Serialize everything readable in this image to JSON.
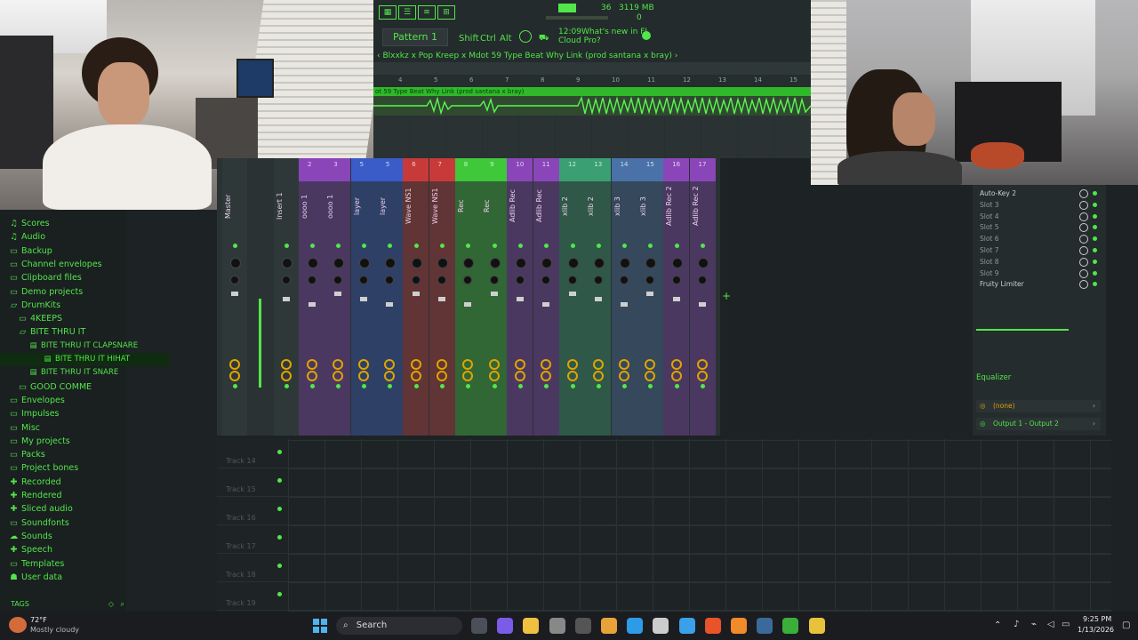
{
  "toolbar": {
    "pattern": "Pattern 1",
    "tempo_display": "36",
    "memory": "3119 MB",
    "cpu": "0",
    "keys": [
      "Shift",
      "Ctrl",
      "Alt"
    ],
    "news_time": "12:09",
    "news_text_1": "What's new in FL",
    "news_text_2": "Cloud Pro?"
  },
  "playlist": {
    "breadcrumb": "Blxxkz x Pop Kreep x Mdot 59 Type Beat Why Link (prod santana x bray)",
    "clip_title": "ot 59 Type Beat Why Link (prod santana x bray)",
    "ruler": [
      "4",
      "5",
      "6",
      "7",
      "8",
      "9",
      "10",
      "11",
      "12",
      "13",
      "14",
      "15"
    ]
  },
  "mixer": {
    "strips": [
      {
        "num": "",
        "label": "Master",
        "color": "#3a4445"
      },
      {
        "num": "",
        "label": "Insert 1",
        "color": "#3a4445"
      },
      {
        "num": "2",
        "label": "oooo 1",
        "color": "#8a46b8"
      },
      {
        "num": "3",
        "label": "oooo 1",
        "color": "#8a46b8"
      },
      {
        "num": "5",
        "label": "layer",
        "color": "#3a5cc8"
      },
      {
        "num": "5",
        "label": "layer",
        "color": "#3a5cc8"
      },
      {
        "num": "6",
        "label": "Wave NS1",
        "color": "#c83a3a"
      },
      {
        "num": "7",
        "label": "Wave NS1",
        "color": "#c83a3a"
      },
      {
        "num": "8",
        "label": "Rec",
        "color": "#3ec83a"
      },
      {
        "num": "9",
        "label": "Rec",
        "color": "#3ec83a"
      },
      {
        "num": "10",
        "label": "Adlib Rec",
        "color": "#8a46b8"
      },
      {
        "num": "11",
        "label": "Adlib Rec",
        "color": "#8a46b8"
      },
      {
        "num": "12",
        "label": "xlib 2",
        "color": "#3aa074"
      },
      {
        "num": "13",
        "label": "xlib 2",
        "color": "#3aa074"
      },
      {
        "num": "14",
        "label": "xlib 3",
        "color": "#4a72a8"
      },
      {
        "num": "15",
        "label": "xlib 3",
        "color": "#4a72a8"
      },
      {
        "num": "16",
        "label": "Adlib Rec 2",
        "color": "#8a46b8"
      },
      {
        "num": "17",
        "label": "Adlib Rec 2",
        "color": "#8a46b8"
      }
    ]
  },
  "browser": {
    "items": [
      {
        "label": "Scores",
        "icon": "note-icon",
        "indent": 0
      },
      {
        "label": "Audio",
        "icon": "note-icon",
        "indent": 0
      },
      {
        "label": "Backup",
        "icon": "folder-icon",
        "indent": 0
      },
      {
        "label": "Channel envelopes",
        "icon": "folder-icon",
        "indent": 0
      },
      {
        "label": "Clipboard files",
        "icon": "folder-icon",
        "indent": 0
      },
      {
        "label": "Demo projects",
        "icon": "folder-icon",
        "indent": 0
      },
      {
        "label": "DrumKits",
        "icon": "folder-open-icon",
        "indent": 0
      },
      {
        "label": "4KEEPS",
        "icon": "folder-icon",
        "indent": 1
      },
      {
        "label": "BITE THRU IT",
        "icon": "folder-open-icon",
        "indent": 1
      },
      {
        "label": "BITE THRU IT CLAPSNARE",
        "icon": "file-icon",
        "indent": 2
      },
      {
        "label": "BITE THRU IT HIHAT",
        "icon": "file-icon",
        "indent": 3
      },
      {
        "label": "BITE THRU IT SNARE",
        "icon": "file-icon",
        "indent": 2
      },
      {
        "label": "GOOD COMME",
        "icon": "folder-icon",
        "indent": 1
      },
      {
        "label": "Envelopes",
        "icon": "folder-icon",
        "indent": 0
      },
      {
        "label": "Impulses",
        "icon": "folder-icon",
        "indent": 0
      },
      {
        "label": "Misc",
        "icon": "folder-icon",
        "indent": 0
      },
      {
        "label": "My projects",
        "icon": "folder-icon",
        "indent": 0
      },
      {
        "label": "Packs",
        "icon": "folder-icon",
        "indent": 0
      },
      {
        "label": "Project bones",
        "icon": "folder-icon",
        "indent": 0
      },
      {
        "label": "Recorded",
        "icon": "plus-icon",
        "indent": 0
      },
      {
        "label": "Rendered",
        "icon": "plus-icon",
        "indent": 0
      },
      {
        "label": "Sliced audio",
        "icon": "plus-icon",
        "indent": 0
      },
      {
        "label": "Soundfonts",
        "icon": "folder-icon",
        "indent": 0
      },
      {
        "label": "Sounds",
        "icon": "cloud-icon",
        "indent": 0
      },
      {
        "label": "Speech",
        "icon": "plus-icon",
        "indent": 0
      },
      {
        "label": "Templates",
        "icon": "folder-icon",
        "indent": 0
      },
      {
        "label": "User data",
        "icon": "user-icon",
        "indent": 0
      }
    ],
    "tags_label": "TAGS"
  },
  "fx": {
    "slots": [
      "Auto-Key 2",
      "Slot 3",
      "Slot 4",
      "Slot 5",
      "Slot 6",
      "Slot 7",
      "Slot 8",
      "Slot 9",
      "Fruity Limiter"
    ],
    "equalizer_label": "Equalizer",
    "input": "(none)",
    "output": "Output 1 - Output 2"
  },
  "tracks": [
    "Track 14",
    "Track 15",
    "Track 16",
    "Track 17",
    "Track 18",
    "Track 19"
  ],
  "taskbar": {
    "weather_temp": "72°F",
    "weather_desc": "Mostly cloudy",
    "search_label": "Search",
    "time": "9:25 PM",
    "date": "1/13/2026"
  }
}
